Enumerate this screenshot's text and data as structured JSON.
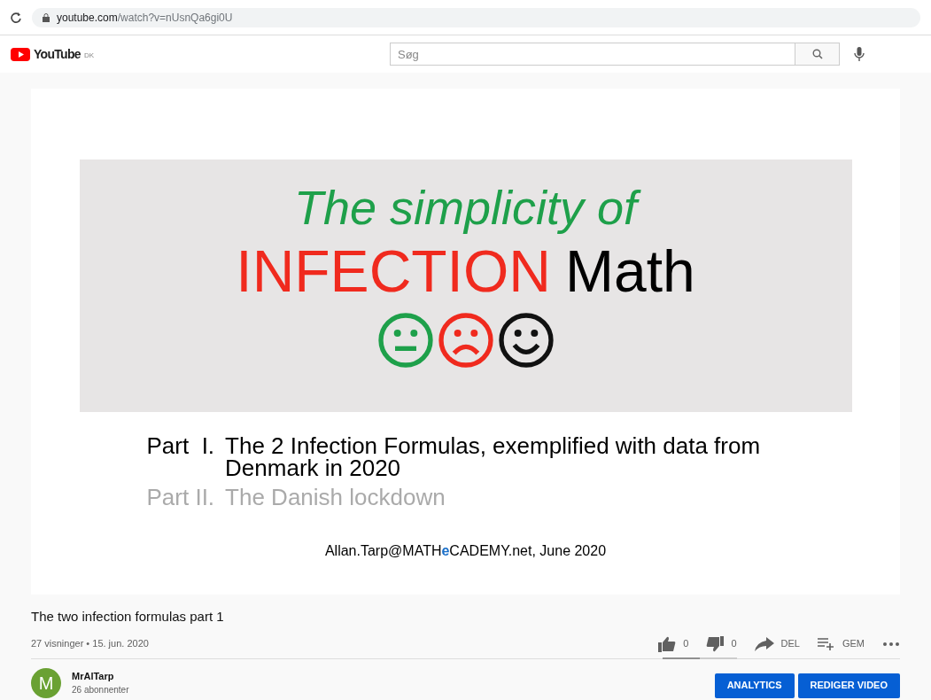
{
  "browser": {
    "url_host": "youtube.com",
    "url_path": "/watch?v=nUsnQa6gi0U"
  },
  "header": {
    "logo": "YouTube",
    "region": "DK",
    "search": {
      "placeholder": "Søg"
    }
  },
  "slide": {
    "title_line1": "The simplicity of",
    "title_word1": "INFECTION",
    "title_word2": "Math",
    "faces": [
      {
        "kind": "neutral",
        "color": "#1ea04a"
      },
      {
        "kind": "sad",
        "color": "#f02a1e"
      },
      {
        "kind": "happy",
        "color": "#111111"
      }
    ],
    "parts": [
      {
        "label": "Part  I.",
        "text": "The 2 Infection Formulas, exemplified with data from Denmark in 2020",
        "dimmed": false
      },
      {
        "label": "Part II.",
        "text": "The Danish lockdown",
        "dimmed": true
      }
    ],
    "credit": "Allan.Tarp@MATH**e**CADEMY.net, June 2020"
  },
  "video": {
    "title": "The two infection formulas part 1",
    "meta": "27 visninger • 15. jun. 2020",
    "actions": [
      {
        "kind": "like",
        "label": "0"
      },
      {
        "kind": "dislike",
        "label": "0"
      },
      {
        "kind": "share",
        "label": "DEL"
      },
      {
        "kind": "save",
        "label": "GEM"
      },
      {
        "kind": "more"
      }
    ],
    "sentiment": {
      "level": 0.5
    }
  },
  "channel": {
    "avatar": "M",
    "name": "MrAlTarp",
    "subscribers": "26 abonnenter",
    "buttons": [
      "ANALYTICS",
      "REDIGER VIDEO"
    ]
  }
}
